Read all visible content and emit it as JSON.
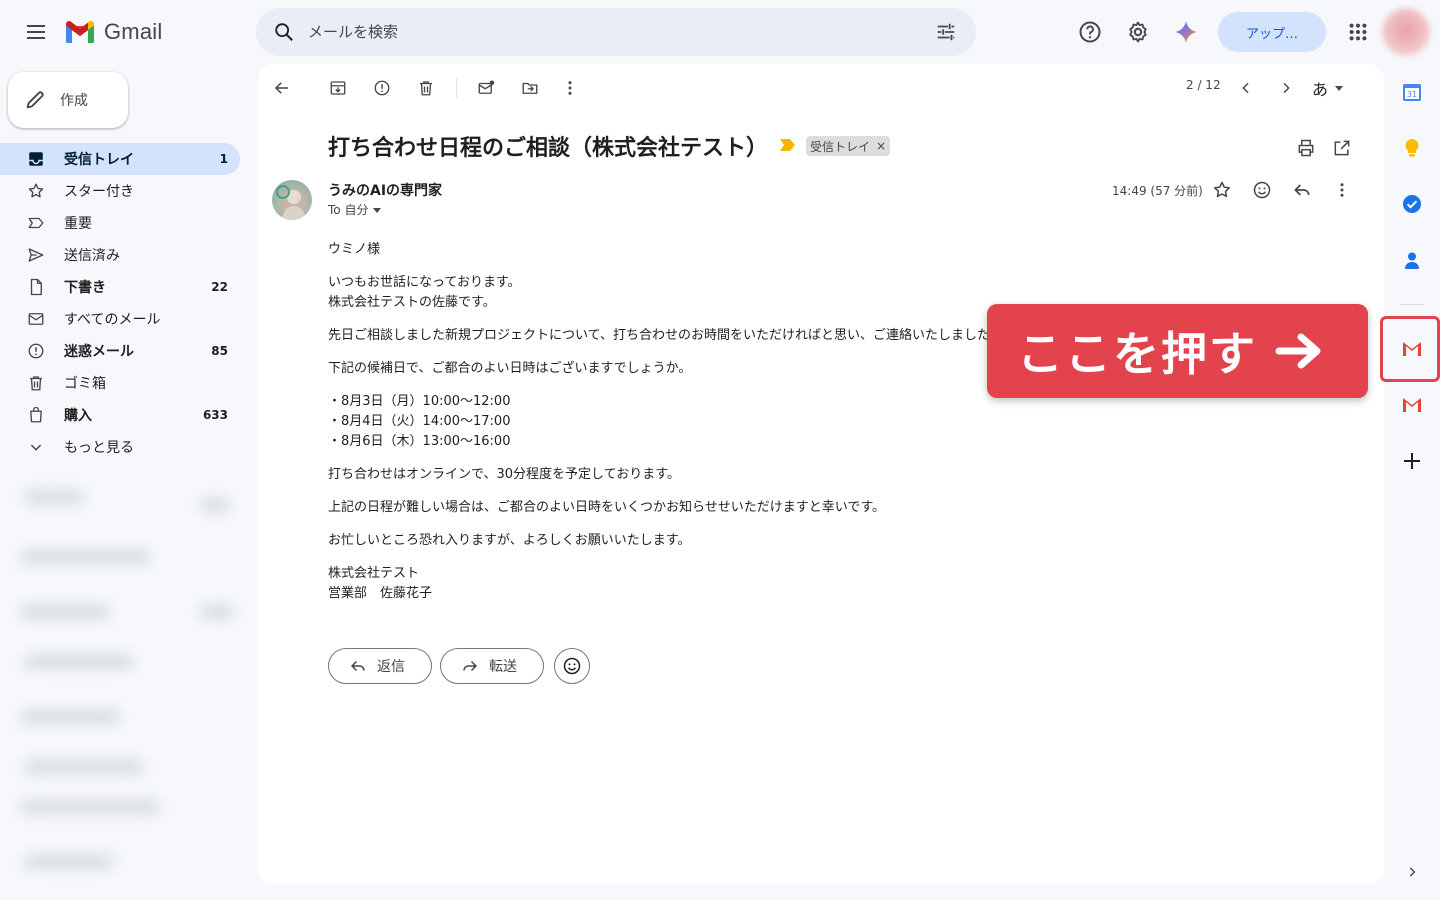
{
  "app": {
    "logo_text": "Gmail"
  },
  "search": {
    "placeholder": "メールを検索"
  },
  "header": {
    "upgrade_label": "アップ…"
  },
  "compose": {
    "label": "作成"
  },
  "nav": {
    "items": [
      {
        "label": "受信トレイ",
        "count": "1"
      },
      {
        "label": "スター付き",
        "count": ""
      },
      {
        "label": "重要",
        "count": ""
      },
      {
        "label": "送信済み",
        "count": ""
      },
      {
        "label": "下書き",
        "count": "22"
      },
      {
        "label": "すべてのメール",
        "count": ""
      },
      {
        "label": "迷惑メール",
        "count": "85"
      },
      {
        "label": "ゴミ箱",
        "count": ""
      },
      {
        "label": "購入",
        "count": "633"
      },
      {
        "label": "もっと見る",
        "count": ""
      }
    ]
  },
  "toolbar": {
    "pager": "2 / 12",
    "input_tool": "あ"
  },
  "message": {
    "subject": "打ち合わせ日程のご相談（株式会社テスト）",
    "label": "受信トレイ",
    "label_close": "×",
    "sender": "うみのAIの専門家",
    "to": "To 自分",
    "time": "14:49 (57 分前)",
    "body": {
      "greeting": "ウミノ様",
      "intro_1": "いつもお世話になっております。",
      "intro_2": "株式会社テストの佐藤です。",
      "p1": "先日ご相談しました新規プロジェクトについて、打ち合わせのお時間をいただければと思い、ご連絡いたしました。",
      "p2": "下記の候補日で、ご都合のよい日時はございますでしょうか。",
      "date_1": "・8月3日（月）10:00〜12:00",
      "date_2": "・8月4日（火）14:00〜17:00",
      "date_3": "・8月6日（木）13:00〜16:00",
      "p3": "打ち合わせはオンラインで、30分程度を予定しております。",
      "p4": "上記の日程が難しい場合は、ご都合のよい日時をいくつかお知らせせいただけますと幸いです。",
      "p5": "お忙しいところ恐れ入りますが、よろしくお願いいたします。",
      "sig_1": "株式会社テスト",
      "sig_2": "営業部　佐藤花子"
    }
  },
  "actions": {
    "reply": "返信",
    "forward": "転送"
  },
  "callout": {
    "text": "ここを押す"
  },
  "colors": {
    "accent": "#0b57d0",
    "callout": "#e3434d",
    "active_nav": "#d3e3fd"
  }
}
